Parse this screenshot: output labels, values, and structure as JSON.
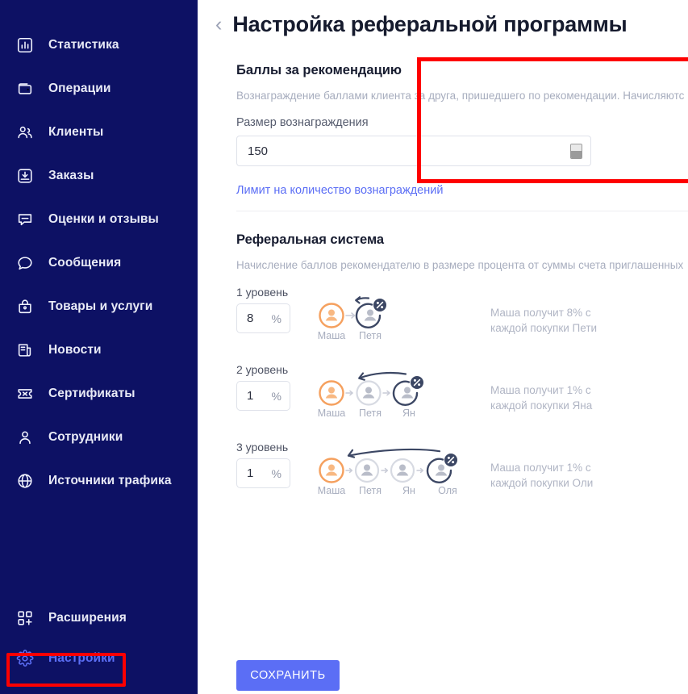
{
  "sidebar": {
    "items": [
      {
        "label": "Статистика",
        "icon": "chart-bar-icon"
      },
      {
        "label": "Операции",
        "icon": "wallet-icon"
      },
      {
        "label": "Клиенты",
        "icon": "users-icon"
      },
      {
        "label": "Заказы",
        "icon": "inbox-download-icon"
      },
      {
        "label": "Оценки и отзывы",
        "icon": "comment-icon"
      },
      {
        "label": "Сообщения",
        "icon": "chat-bubble-icon"
      },
      {
        "label": "Товары и услуги",
        "icon": "bag-icon"
      },
      {
        "label": "Новости",
        "icon": "news-icon"
      },
      {
        "label": "Сертификаты",
        "icon": "ticket-icon"
      },
      {
        "label": "Сотрудники",
        "icon": "person-icon"
      },
      {
        "label": "Источники трафика",
        "icon": "globe-icon"
      }
    ],
    "bottom_items": [
      {
        "label": "Расширения",
        "icon": "extensions-icon",
        "active": false
      },
      {
        "label": "Настройки",
        "icon": "gear-icon",
        "active": true
      }
    ]
  },
  "header": {
    "back_icon": "chevron-left-icon",
    "title": "Настройка реферальной программы"
  },
  "points_block": {
    "title": "Баллы за рекомендацию",
    "description": "Вознаграждение баллами клиента за друга, пришедшего по рекомендации. Начисляютс",
    "field_label": "Размер вознаграждения",
    "value": "150",
    "stepper_icon": "number-stepper-icon",
    "limit_link": "Лимит на количество вознаграждений"
  },
  "referral_block": {
    "title": "Реферальная система",
    "description": "Начисление баллов рекомендателю в размере процента от суммы счета приглашенных",
    "levels": [
      {
        "name": "1 уровень",
        "percent": "8",
        "suffix": "%",
        "chain": [
          "Маша",
          "Петя"
        ],
        "note_line1": "Маша получит 8% с",
        "note_line2": "каждой покупки Пети"
      },
      {
        "name": "2 уровень",
        "percent": "1",
        "suffix": "%",
        "chain": [
          "Маша",
          "Петя",
          "Ян"
        ],
        "note_line1": "Маша получит 1% с",
        "note_line2": "каждой покупки Яна"
      },
      {
        "name": "3 уровень",
        "percent": "1",
        "suffix": "%",
        "chain": [
          "Маша",
          "Петя",
          "Ян",
          "Оля"
        ],
        "note_line1": "Маша получит 1% с",
        "note_line2": "каждой покупки Оли"
      }
    ]
  },
  "footer": {
    "save_label": "СОХРАНИТЬ"
  },
  "colors": {
    "sidebar_bg": "#0d1164",
    "accent_blue": "#5b6ef5",
    "annotation_red": "#fe0000",
    "avatar_orange": "#f5a05e",
    "avatar_dark": "#3c4764",
    "muted_text": "#a7adbe"
  }
}
